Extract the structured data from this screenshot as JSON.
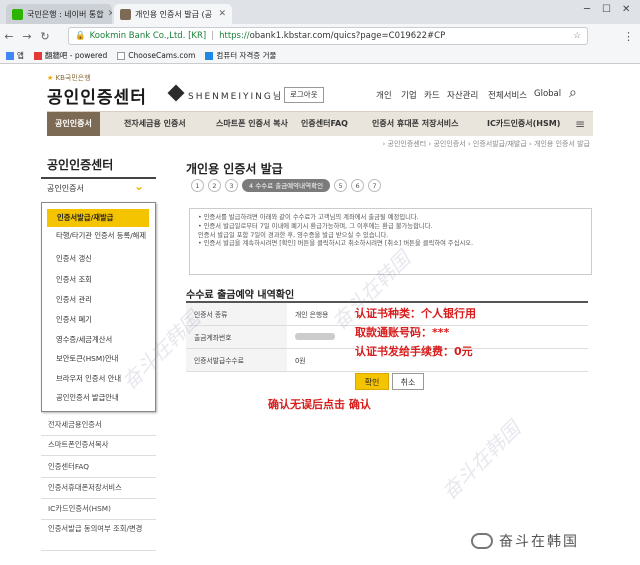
{
  "browser": {
    "tabs": [
      {
        "title": "국민은행 : 네이버 통합",
        "active": false,
        "favicon_color": "#2db400"
      },
      {
        "title": "개인용 인증서 발급 (공",
        "active": true,
        "favicon_color": "#7d6a54"
      }
    ],
    "url": {
      "org": "Kookmin Bank Co.,Ltd. [KR]",
      "scheme": "https://",
      "rest": "obank1.kbstar.com/quics?page=C019622#CP"
    },
    "bookmarks": [
      {
        "label": "앱",
        "icon": "apps-icon",
        "color": "#4285f4"
      },
      {
        "label": "翻牆吧 - powered",
        "icon": "bookmark-icon",
        "color": "#e53935"
      },
      {
        "label": "ChooseCams.com",
        "icon": "page-icon",
        "color": "#ffffff"
      },
      {
        "label": "컴퓨터 자격증 거물",
        "icon": "gsc-icon",
        "color": "#1e88e5"
      }
    ]
  },
  "site": {
    "brand_small": "KB국민은행",
    "brand_main": "공인인증센터",
    "user_name": "SHENMEIYING님",
    "logout_label": "로그아웃",
    "top_nav": [
      "개인",
      "기업",
      "카드",
      "자산관리",
      "전체서비스",
      "Global"
    ],
    "gnb": [
      "공인인증서",
      "전자세금용 인증서",
      "스마트폰 인증서 복사",
      "인증센터FAQ",
      "인증서 휴대폰 저장서비스",
      "IC카드인증서(HSM)"
    ],
    "breadcrumb": "› 공인인증센터 › 공인인증서 › 인증서발급/재발급 › 개인용 인증서 발급"
  },
  "sidebar": {
    "title": "공인인증센터",
    "selected": "공인인증서",
    "dropdown": [
      "인증서발급/재발급",
      "타행/타기관 인증서 등록/해제",
      "인증서 갱신",
      "인증서 조회",
      "인증서 관리",
      "인증서 폐기",
      "영수증/세금계산서",
      "보안토큰(HSM)안내",
      "브라우저 인증서 안내",
      "공인인증서 발급안내"
    ],
    "rest": [
      "전자세금용인증서",
      "스마트폰인증서복사",
      "인증센터FAQ",
      "인증서휴대폰저장서비스",
      "IC카드인증서(HSM)",
      "인증서발급 동의여부 조회/변경"
    ]
  },
  "main": {
    "title": "개인용 인증서 발급",
    "steps": [
      "1",
      "2",
      "3",
      "4 수수료 출금예약내역확인",
      "5",
      "6",
      "7"
    ],
    "notice": [
      "• 인증서를 발급하려면 아래와 같이 수수료가 고객님의 계좌에서 출금될 예정입니다.",
      "• 인증서 발급일로부터 7일 이내에 폐기시 환급가능하며, 그 이후에는 환급 불가능합니다.",
      "  인증서 발급일 포함 7일이 경과한 후, 영수증을 발급 받으실 수 있습니다.",
      "• 인증서 발급을 계속하시려면 [확인] 버튼을 클릭하시고 취소하시려면 [취소] 버튼을 클릭하여 주십시오."
    ],
    "section_title": "수수료 출금예약 내역확인",
    "rows": [
      {
        "key": "인증서 종류",
        "value": "개인 은행용"
      },
      {
        "key": "출금계좌번호",
        "value": ""
      },
      {
        "key": "인증서발급수수료",
        "value": "0원"
      }
    ],
    "confirm_label": "확인",
    "cancel_label": "취소"
  },
  "annotations": {
    "line1": "认证书种类：个人银行用",
    "line2": "取款通账号码：***",
    "line3": "认证书发给手续费：0元",
    "line4": "确认无误后点击 确认",
    "color": "#d81c1c"
  },
  "footer_brand": "奋斗在韩国",
  "watermark": "奋斗在韩国"
}
